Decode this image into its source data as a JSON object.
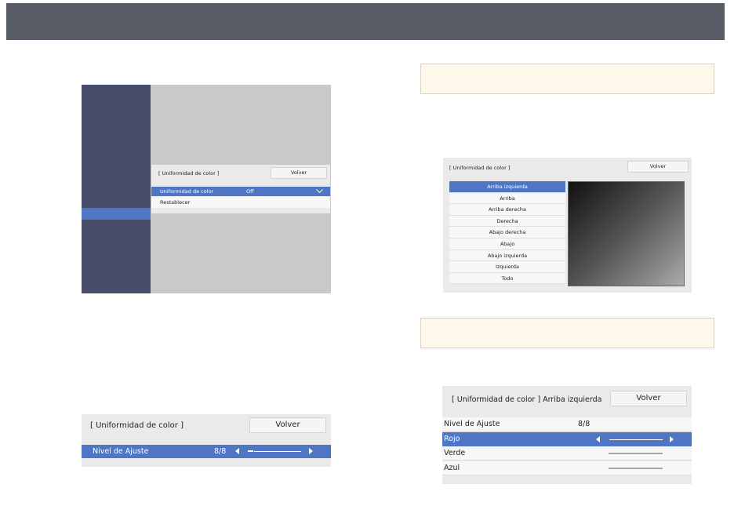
{
  "panel_a": {
    "title": "[ Uniformidad de color ]",
    "back": "Volver",
    "item1_label": "Uniformidad de color",
    "item1_value": "Off",
    "item2_label": "Restablecer"
  },
  "panel_b": {
    "title": "[ Uniformidad de color ]",
    "back": "Volver",
    "items": [
      "Arriba izquierda",
      "Arriba",
      "Arriba derecha",
      "Derecha",
      "Abajo derecha",
      "Abajo",
      "Abajo izquierda",
      "Izquierda",
      "Todo"
    ]
  },
  "panel_c": {
    "title": "[ Uniformidad de color ]",
    "back": "Volver",
    "row_label": "Nivel de Ajuste",
    "row_value": "8/8"
  },
  "panel_d": {
    "title": "[ Uniformidad de color ] Arriba izquierda",
    "back": "Volver",
    "level_label": "Nivel de Ajuste",
    "level_value": "8/8",
    "rows": [
      "Rojo",
      "Verde",
      "Azul"
    ]
  }
}
